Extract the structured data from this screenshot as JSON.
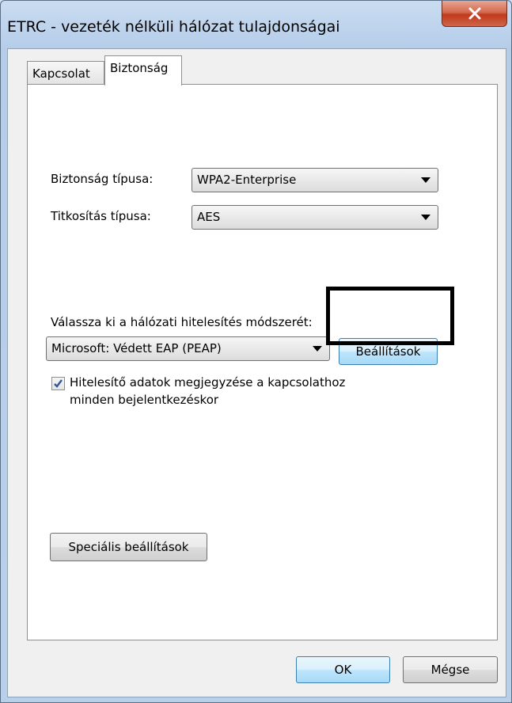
{
  "window": {
    "title": "ETRC - vezeték nélküli hálózat tulajdonságai",
    "close_label": "X"
  },
  "tabs": [
    {
      "label": "Kapcsolat",
      "selected": false
    },
    {
      "label": "Biztonság",
      "selected": true
    }
  ],
  "security": {
    "type_label": "Biztonság típusa:",
    "type_value": "WPA2-Enterprise",
    "encryption_label": "Titkosítás típusa:",
    "encryption_value": "AES"
  },
  "auth": {
    "method_label": "Válassza ki a hálózati hitelesítés módszerét:",
    "method_value": "Microsoft: Védett EAP (PEAP)",
    "settings_button": "Beállítások",
    "remember_checked": true,
    "remember_label_line1": "Hitelesítő adatok megjegyzése a kapcsolathoz",
    "remember_label_line2": "minden bejelentkezéskor"
  },
  "advanced_button": "Speciális beállítások",
  "footer": {
    "ok": "OK",
    "cancel": "Mégse"
  },
  "colors": {
    "highlight_border": "#000000",
    "close_button": "#c0391c"
  }
}
